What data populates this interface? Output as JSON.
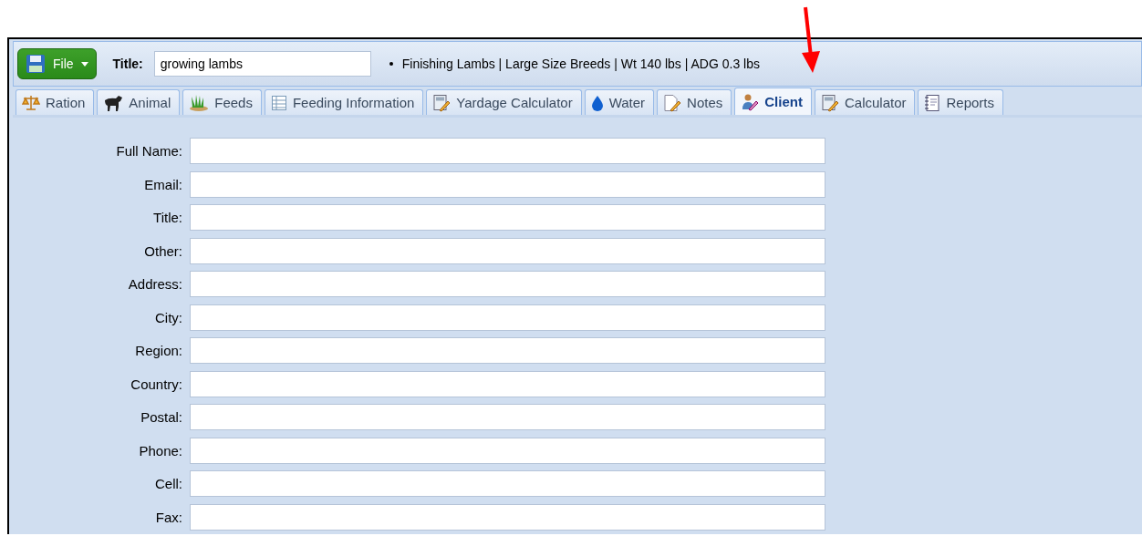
{
  "toolbar": {
    "file_button": "File",
    "title_label": "Title:",
    "title_value": "growing lambs",
    "summary": "Finishing Lambs | Large Size Breeds | Wt 140 lbs | ADG 0.3 lbs"
  },
  "tabs": [
    {
      "label": "Ration",
      "kind": "scale",
      "selected": false
    },
    {
      "label": "Animal",
      "kind": "animal",
      "selected": false
    },
    {
      "label": "Feeds",
      "kind": "grass",
      "selected": false
    },
    {
      "label": "Feeding Information",
      "kind": "table",
      "selected": false
    },
    {
      "label": "Yardage Calculator",
      "kind": "calculator",
      "selected": false
    },
    {
      "label": "Water",
      "kind": "drop",
      "selected": false
    },
    {
      "label": "Notes",
      "kind": "note",
      "selected": false
    },
    {
      "label": "Client",
      "kind": "user",
      "selected": true
    },
    {
      "label": "Calculator",
      "kind": "calculator",
      "selected": false
    },
    {
      "label": "Reports",
      "kind": "notebook",
      "selected": false
    }
  ],
  "form": {
    "fields": [
      {
        "label": "Full Name:"
      },
      {
        "label": "Email:"
      },
      {
        "label": "Title:"
      },
      {
        "label": "Other:"
      },
      {
        "label": "Address:"
      },
      {
        "label": "City:"
      },
      {
        "label": "Region:"
      },
      {
        "label": "Country:"
      },
      {
        "label": "Postal:"
      },
      {
        "label": "Phone:"
      },
      {
        "label": "Cell:"
      },
      {
        "label": "Fax:"
      }
    ]
  }
}
